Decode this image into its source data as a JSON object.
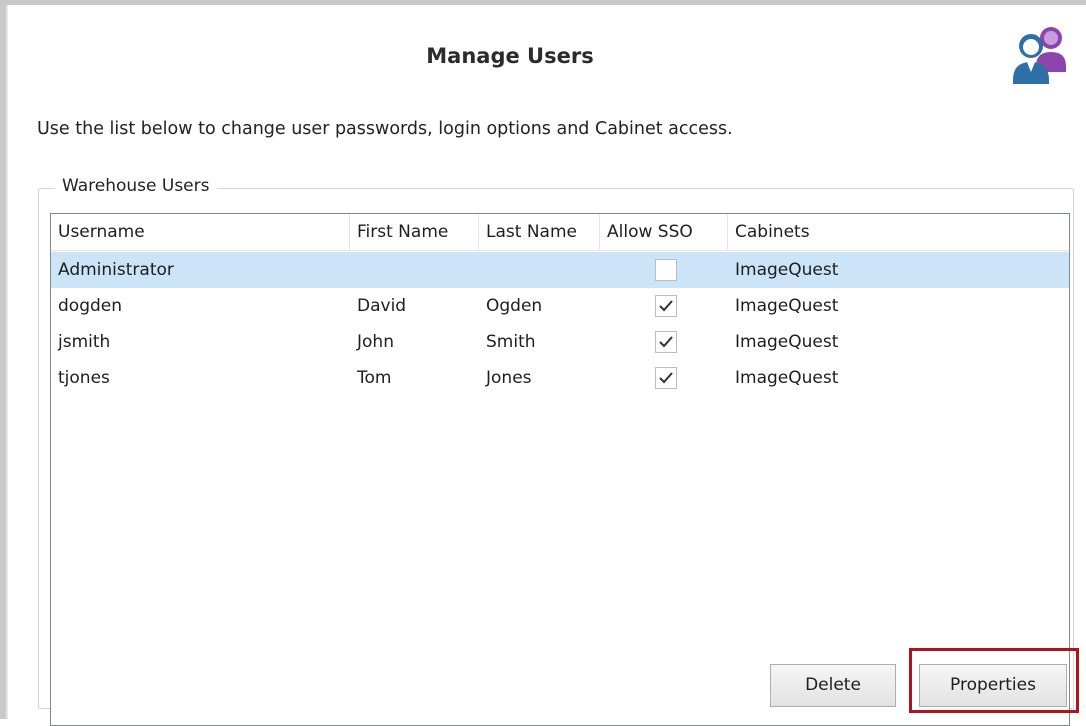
{
  "dialog": {
    "title": "Manage Users",
    "description": "Use the list below to change user passwords, login options and Cabinet access."
  },
  "group": {
    "legend": "Warehouse Users"
  },
  "table": {
    "columns": [
      "Username",
      "First Name",
      "Last Name",
      "Allow SSO",
      "Cabinets"
    ],
    "rows": [
      {
        "username": "Administrator",
        "first_name": "",
        "last_name": "",
        "allow_sso": false,
        "cabinets": "ImageQuest",
        "selected": true
      },
      {
        "username": "dogden",
        "first_name": "David",
        "last_name": "Ogden",
        "allow_sso": true,
        "cabinets": "ImageQuest",
        "selected": false
      },
      {
        "username": "jsmith",
        "first_name": "John",
        "last_name": "Smith",
        "allow_sso": true,
        "cabinets": "ImageQuest",
        "selected": false
      },
      {
        "username": "tjones",
        "first_name": "Tom",
        "last_name": "Jones",
        "allow_sso": true,
        "cabinets": "ImageQuest",
        "selected": false
      }
    ]
  },
  "buttons": {
    "delete_label": "Delete",
    "properties_label": "Properties"
  },
  "icons": {
    "header_icon": "users-icon",
    "checkbox_check": "checkmark-icon"
  },
  "colors": {
    "selected_row": "#cce4f7",
    "highlight": "#b0121e",
    "icon_blue": "#2e6fa7",
    "icon_purple": "#8e44ad"
  }
}
